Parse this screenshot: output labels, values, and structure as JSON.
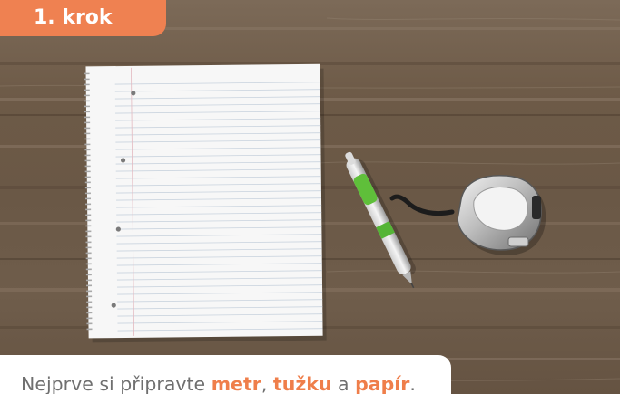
{
  "step": {
    "label": "1. krok"
  },
  "caption": {
    "lead": "Nejprve si připravte ",
    "item1": "metr",
    "sep1": ", ",
    "item2": "tužku",
    "sep2": " a ",
    "item3": "papír",
    "tail": "."
  },
  "colors": {
    "accent": "#ef8151",
    "highlight_text": "#ef7e4a",
    "body_text": "#6f6f6f",
    "wood": "#6e5b49"
  },
  "photo": {
    "depicts": [
      "spiral-notebook",
      "pen",
      "tape-measure"
    ]
  }
}
